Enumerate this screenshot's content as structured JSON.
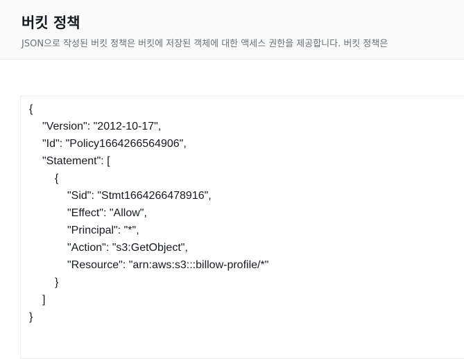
{
  "panel": {
    "title": "버킷 정책",
    "description": "JSON으로 작성된 버킷 정책은 버킷에 저장된 객체에 대한 액세스 권한을 제공합니다. 버킷 정책은"
  },
  "policy": {
    "lines": [
      "{",
      "\"Version\": \"2012-10-17\",",
      "\"Id\": \"Policy1664266564906\",",
      "\"Statement\": [",
      "{",
      "\"Sid\": \"Stmt1664266478916\",",
      "\"Effect\": \"Allow\",",
      "\"Principal\": \"*\",",
      "\"Action\": \"s3:GetObject\",",
      "\"Resource\": \"arn:aws:s3:::billow-profile/*\"",
      "}",
      "]",
      "}"
    ]
  }
}
